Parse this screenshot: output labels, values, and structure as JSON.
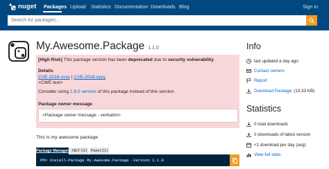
{
  "header": {
    "brand": "nuget",
    "nav": [
      "Packages",
      "Upload",
      "Statistics",
      "Documentation",
      "Downloads",
      "Blog"
    ],
    "sign_in": "Sign in",
    "search_placeholder": "Search for packages...",
    "brand_color": "#004880",
    "accent_color": "#f19c25"
  },
  "package": {
    "name": "My.Awesome.Package",
    "version": "1.1.0",
    "description": "This is my awesome package"
  },
  "deprecation": {
    "risk_label": "[High Risk]",
    "msg_pre": " This package version has been ",
    "msg_deprecated": "deprecated",
    "msg_mid": " due to ",
    "msg_reason": "security vulnerability",
    "msg_end": ".",
    "details_heading": "Details",
    "cve_1": "CVE-2018-xxxx",
    "cve_separator": "|",
    "cve_2": "CVE-2018-yyyy",
    "cve_text": "<CWE text>",
    "consider_pre": "Consider using ",
    "consider_link": "1.8.0 version",
    "consider_post": " of this package instead of this version.",
    "owner_heading": "Package owner message",
    "owner_message": "<Package owner message - verbatim>",
    "background_color": "#f8d7da"
  },
  "install": {
    "tabs": [
      "Package Manager",
      ".NET CLI",
      "Paket CLI"
    ],
    "active_tab": "Package Manager",
    "command": "PM> Install-Package My.Awesome.Package -Version 1.1.0"
  },
  "sidebar": {
    "info_title": "Info",
    "last_updated": "last updated a day ago",
    "contact_owners": "Contact owners",
    "report": "Report",
    "download_package": "Download Package",
    "download_size": "(13.33 KB)",
    "stats_title": "Statistics",
    "total_downloads": "0 total downloads",
    "latest_downloads": "0 downloads of latest version",
    "per_day": "<1 download per day (avg)",
    "view_full_stats": "View full stats"
  }
}
